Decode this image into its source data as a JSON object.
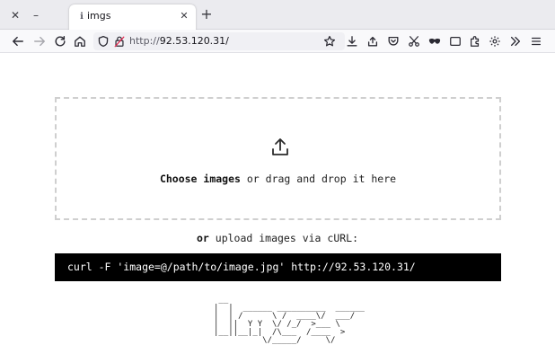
{
  "window": {
    "close_glyph": "✕",
    "minimize_glyph": "–"
  },
  "tabs": [
    {
      "favicon": "ℹ",
      "title": "imgs",
      "close_glyph": "✕"
    }
  ],
  "newtab_glyph": "+",
  "toolbar": {
    "icons": [
      "back-icon",
      "forward-icon",
      "reload-icon",
      "home-icon",
      "shield-icon",
      "insecure-lock-icon",
      "bookmark-star-icon",
      "downloads-icon",
      "save-to-pocket-icon",
      "pocket-icon",
      "screenshot-icon",
      "mask-icon",
      "sidebar-icon",
      "extensions-icon",
      "settings-icon",
      "overflow-chevrons-icon",
      "menu-icon"
    ]
  },
  "url": {
    "scheme": "http://",
    "host_path": "92.53.120.31/"
  },
  "dropzone": {
    "choose_label": "Choose images",
    "rest_text": " or drag and drop it here",
    "icon": "upload-icon"
  },
  "curl": {
    "prefix_bold": "or",
    "text": " upload images via cURL:",
    "command": "curl -F 'image=@/path/to/image.jpg' http://92.53.120.31/"
  },
  "logo_ascii": " __\n|  |  ______ __________  ______\n|  | /      \\ /  ____\\/  ___/\n|  ||  Y Y  \\/ /_/  >___ \\\n|__||__|_|  /\\___  /____  >\n          \\/_____/     \\/"
}
